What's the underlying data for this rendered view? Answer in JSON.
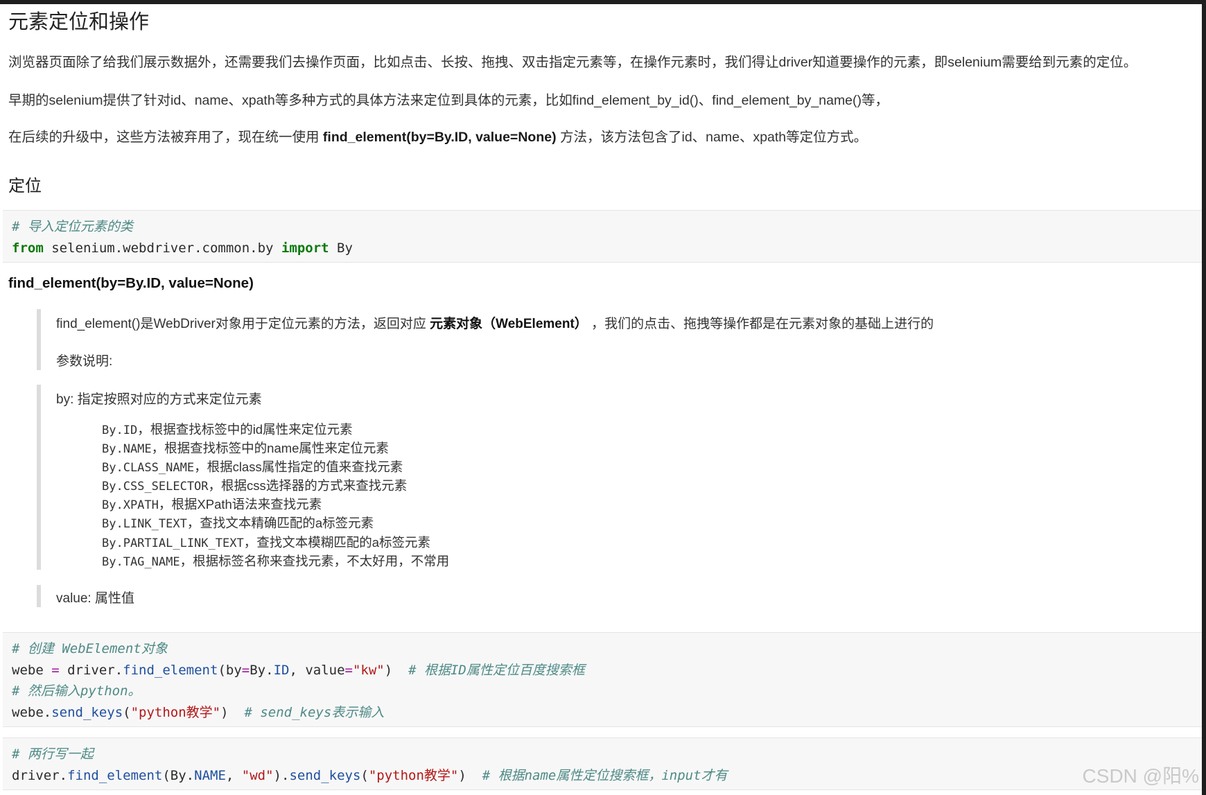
{
  "title": "元素定位和操作",
  "para1": "浏览器页面除了给我们展示数据外，还需要我们去操作页面，比如点击、长按、拖拽、双击指定元素等，在操作元素时，我们得让driver知道要操作的元素，即selenium需要给到元素的定位。",
  "para2": "早期的selenium提供了针对id、name、xpath等多种方式的具体方法来定位到具体的元素，比如find_element_by_id()、find_element_by_name()等，",
  "para3": {
    "before": "在后续的升级中，这些方法被弃用了，现在统一使用 ",
    "bold": "find_element(by=By.ID, value=None)",
    "after": " 方法，该方法包含了id、name、xpath等定位方式。"
  },
  "section_heading": "定位",
  "code1": {
    "comment": "# 导入定位元素的类",
    "kw_from": "from",
    "module": " selenium.webdriver.common.by ",
    "kw_import": "import",
    "name": " By"
  },
  "signature": "find_element(by=By.ID, value=None)",
  "quote1": {
    "text_before": "find_element()是WebDriver对象用于定位元素的方法，返回对应 ",
    "bold": "元素对象（WebElement）",
    "text_after": " ，我们的点击、拖拽等操作都是在元素对象的基础上进行的",
    "param_label": "参数说明:"
  },
  "quote2": {
    "by_label": "by: 指定按照对应的方式来定位元素",
    "items": [
      {
        "key": "By.ID",
        "desc": "，根据查找标签中的id属性来定位元素"
      },
      {
        "key": "By.NAME",
        "desc": "，根据查找标签中的name属性来定位元素"
      },
      {
        "key": "By.CLASS_NAME",
        "desc": "，根据class属性指定的值来查找元素"
      },
      {
        "key": "By.CSS_SELECTOR",
        "desc": "，根据css选择器的方式来查找元素"
      },
      {
        "key": "By.XPATH",
        "desc": "，根据XPath语法来查找元素"
      },
      {
        "key": "By.LINK_TEXT",
        "desc": "，查找文本精确匹配的a标签元素"
      },
      {
        "key": "By.PARTIAL_LINK_TEXT",
        "desc": "，查找文本模糊匹配的a标签元素"
      },
      {
        "key": "By.TAG_NAME",
        "desc": "，根据标签名称来查找元素，不太好用，不常用"
      }
    ]
  },
  "quote3": {
    "value_label": "value: 属性值"
  },
  "code2": {
    "l1_comment": "# 创建 WebElement对象",
    "l2_var": "webe ",
    "l2_eq": "=",
    "l2_obj": " driver.",
    "l2_fn": "find_element",
    "l2_p1": "(by",
    "l2_eq2": "=",
    "l2_by": "By.",
    "l2_attr": "ID",
    "l2_p2": ", value",
    "l2_eq3": "=",
    "l2_str": "\"kw\"",
    "l2_p3": ")  ",
    "l2_comment": "# 根据ID属性定位百度搜索框",
    "l3_comment": "# 然后输入python。",
    "l4_var": "webe.",
    "l4_fn": "send_keys",
    "l4_p1": "(",
    "l4_str": "\"python教学\"",
    "l4_p2": ")  ",
    "l4_comment": "# send_keys表示输入"
  },
  "code3": {
    "l1_comment": "# 两行写一起",
    "l2_obj": "driver.",
    "l2_fn": "find_element",
    "l2_p1": "(By.",
    "l2_attr": "NAME",
    "l2_p2": ", ",
    "l2_str": "\"wd\"",
    "l2_p3": ").",
    "l2_fn2": "send_keys",
    "l2_p4": "(",
    "l2_str2": "\"python教学\"",
    "l2_p5": ")  ",
    "l2_comment": "# 根据name属性定位搜索框，input才有"
  },
  "watermark": "CSDN @阳%"
}
